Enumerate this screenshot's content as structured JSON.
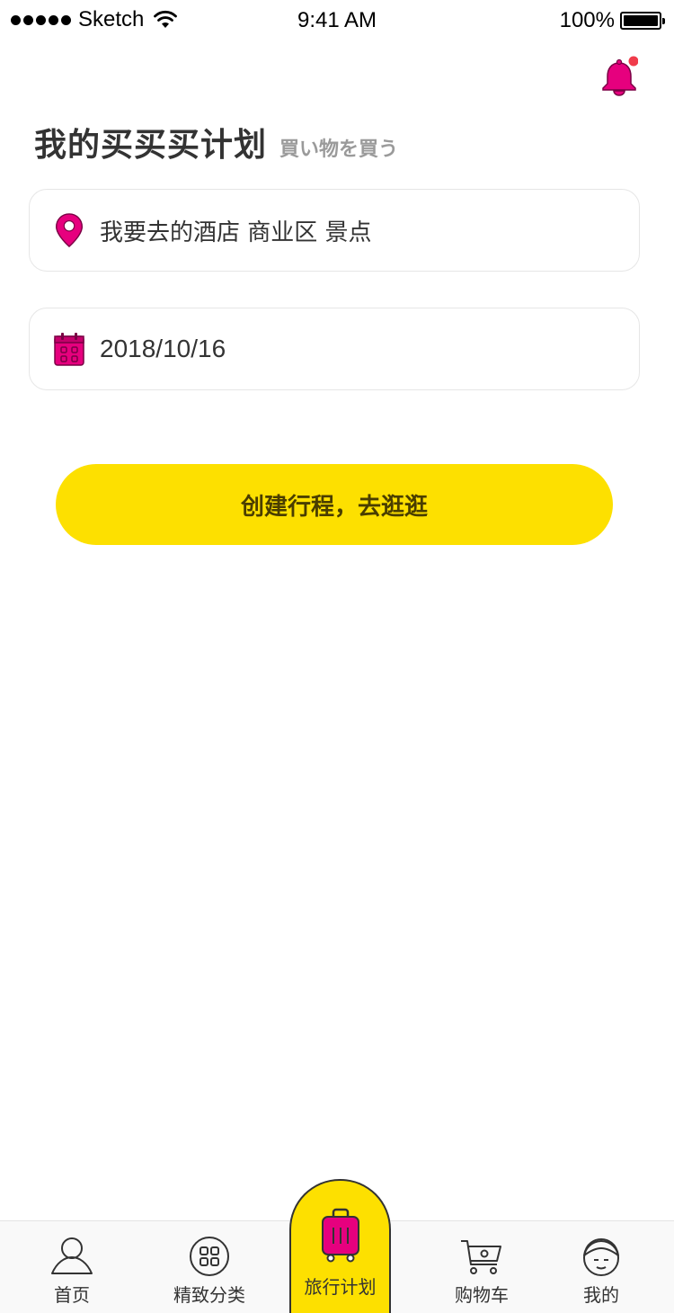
{
  "status_bar": {
    "carrier": "Sketch",
    "time": "9:41 AM",
    "battery": "100%"
  },
  "header": {
    "title": "我的买买买计划",
    "subtitle": "買い物を買う",
    "notification_dot_color": "#f03c4b"
  },
  "form": {
    "destination_value": "我要去的酒店 商业区 景点",
    "date_value": "2018/10/16"
  },
  "cta": {
    "label": "创建行程，去逛逛"
  },
  "tabbar": {
    "items": [
      {
        "label": "首页",
        "icon": "home-icon"
      },
      {
        "label": "精致分类",
        "icon": "category-icon"
      },
      {
        "label": "旅行计划",
        "icon": "luggage-icon",
        "active": true
      },
      {
        "label": "购物车",
        "icon": "cart-icon"
      },
      {
        "label": "我的",
        "icon": "profile-icon"
      }
    ]
  },
  "colors": {
    "accent": "#fde000",
    "brand_pink": "#e6007e",
    "text": "#333333",
    "muted": "#9a9a9a"
  }
}
